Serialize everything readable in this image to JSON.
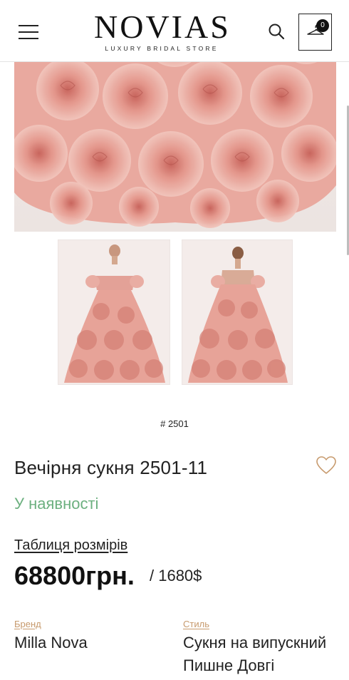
{
  "header": {
    "logo_main": "NOVIAS",
    "logo_sub": "LUXURY BRIDAL STORE",
    "cart_count": "0",
    "menu_icon": "hamburger-menu-icon",
    "search_icon": "search-icon",
    "cart_icon": "hanger-icon"
  },
  "product": {
    "article": "# 2501",
    "title": "Вечірня сукня 2501-11",
    "availability": "У наявності",
    "size_table_link": "Таблиця розмірів",
    "price": "68800грн.",
    "price_usd": "/ 1680$",
    "wishlist_icon": "heart-icon"
  },
  "attributes": {
    "brand_label": "Бренд",
    "brand_value": "Milla Nova",
    "style_label": "Стиль",
    "style_value_1": "Сукня на випускний",
    "style_value_2": "Пишне Довгі"
  },
  "colors": {
    "availability": "#6cb07f",
    "attr_label": "#c79a6d",
    "dress_pink": "#e5a096"
  }
}
